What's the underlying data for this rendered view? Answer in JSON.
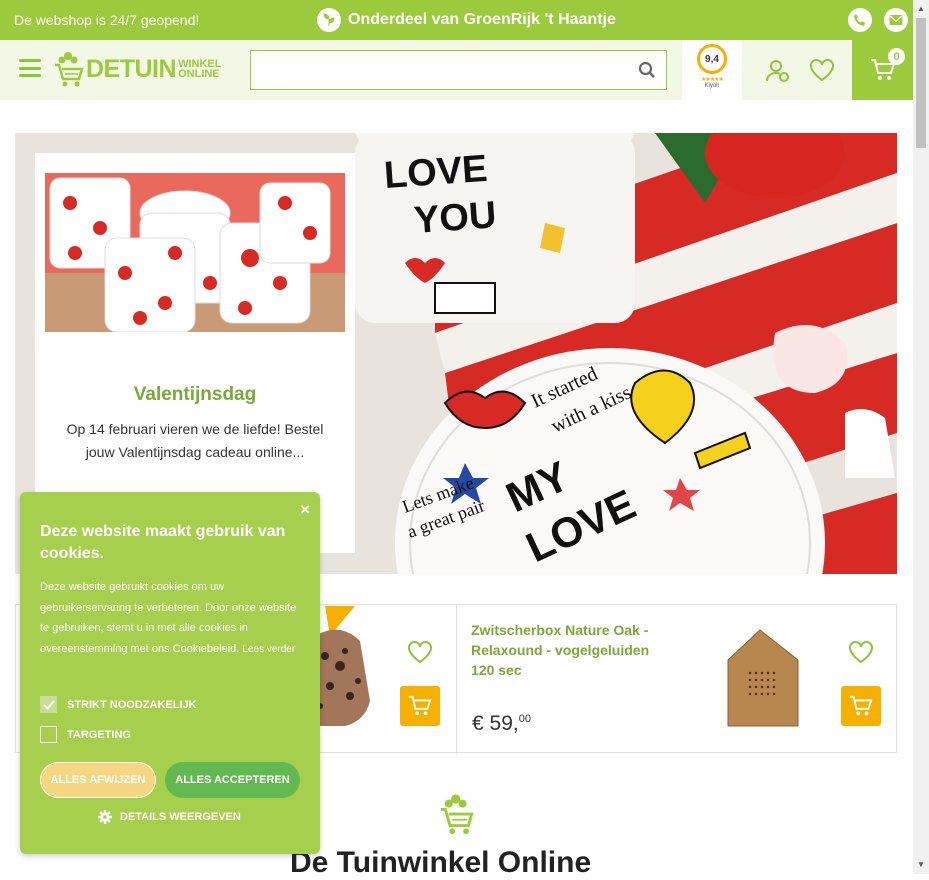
{
  "topbar": {
    "left_text": "De webshop is 24/7 geopend!",
    "center_text": "Onderdeel van GroenRijk 't Haantje",
    "icons": [
      "leaf-icon",
      "phone-icon",
      "mail-icon"
    ]
  },
  "header": {
    "logo_main": "DETUIN",
    "logo_sub_1": "WINKEL",
    "logo_sub_2": "ONLINE",
    "search_placeholder": "",
    "rating": "9,4",
    "rating_source": "Kiyoh",
    "cart_count": "0",
    "icons": [
      "menu-icon",
      "search-icon",
      "account-icon",
      "heart-icon",
      "cart-icon"
    ]
  },
  "hero_card": {
    "title": "Valentijnsdag",
    "description": "Op 14 februari vieren we de liefde! Bestel jouw Valentijnsdag cadeau online..."
  },
  "products": [
    {
      "title": "Zwitscherbox Nature Oak - Relaxound - vogelgeluiden 120 sec",
      "price_main": "€ 59,",
      "price_cents": "00"
    }
  ],
  "section": {
    "title": "De Tuinwinkel Online"
  },
  "cookie_banner": {
    "close_label": "×",
    "heading": "Deze website maakt gebruik van cookies.",
    "body": "Deze website gebruikt cookies om uw gebruikerservaring te verbeteren. Door onze website te gebruiken, stemt u in met alle cookies in overeenstemming met ons Cookiebeleid.",
    "read_more": "Lees verder",
    "options": [
      {
        "label": "STRIKT NOODZAKELIJK",
        "checked": true
      },
      {
        "label": "TARGETING",
        "checked": false
      }
    ],
    "reject_label": "ALLES AFWIJZEN",
    "accept_label": "ALLES ACCEPTEREN",
    "details_label": "DETAILS WEERGEVEN"
  },
  "colors": {
    "brand_green": "#9bcb3c",
    "title_green": "#7aa93a",
    "cart_yellow": "#f6b000",
    "cookie_green": "#a6cf4d",
    "accept_green": "#64b852"
  }
}
